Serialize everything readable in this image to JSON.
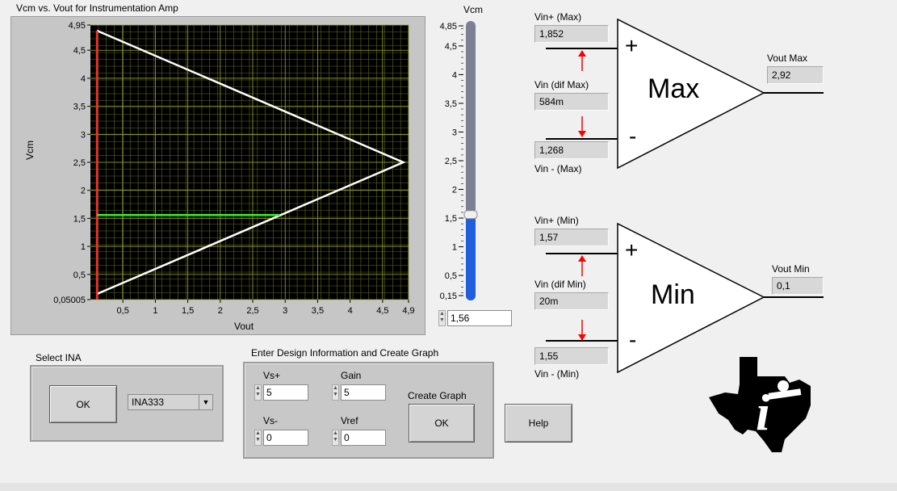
{
  "graph": {
    "title": "Vcm vs. Vout for Instrumentation Amp",
    "xlabel": "Vout",
    "ylabel": "Vcm"
  },
  "chart_data": {
    "type": "line",
    "title": "Vcm vs. Vout for Instrumentation Amp",
    "xlabel": "Vout",
    "ylabel": "Vcm",
    "xlim": [
      0,
      4.9
    ],
    "ylim": [
      0.05005,
      4.95
    ],
    "grid": true,
    "x_ticks": [
      "0,5",
      "1",
      "1,5",
      "2",
      "2,5",
      "3",
      "3,5",
      "4",
      "4,5",
      "4,9"
    ],
    "x_tick_values": [
      0.5,
      1,
      1.5,
      2,
      2.5,
      3,
      3.5,
      4,
      4.5,
      4.9
    ],
    "y_ticks": [
      "0,05005",
      "0,5",
      "1",
      "1,5",
      "2",
      "2,5",
      "3",
      "3,5",
      "4",
      "4,5",
      "4,95"
    ],
    "y_tick_values": [
      0.05005,
      0.5,
      1,
      1.5,
      2,
      2.5,
      3,
      3.5,
      4,
      4.5,
      4.95
    ],
    "series": [
      {
        "color": "#ffffff",
        "x": [
          0.1,
          4.82,
          0.1
        ],
        "y": [
          4.85,
          2.5,
          0.15
        ]
      },
      {
        "color": "#ff2a2a",
        "x": [
          0.1,
          0.1
        ],
        "y": [
          0.05005,
          4.85
        ]
      },
      {
        "color": "#33ee33",
        "x": [
          0.1,
          2.92
        ],
        "y": [
          1.56,
          1.56
        ]
      }
    ]
  },
  "slider": {
    "title": "Vcm",
    "max": 4.85,
    "min": 0.15,
    "value": 1.56,
    "value_text": "1,56",
    "tick_labels": [
      {
        "v": 4.85,
        "t": "4,85"
      },
      {
        "v": 4.5,
        "t": "4,5"
      },
      {
        "v": 4,
        "t": "4"
      },
      {
        "v": 3.5,
        "t": "3,5"
      },
      {
        "v": 3,
        "t": "3"
      },
      {
        "v": 2.5,
        "t": "2,5"
      },
      {
        "v": 2,
        "t": "2"
      },
      {
        "v": 1.5,
        "t": "1,5"
      },
      {
        "v": 1,
        "t": "1"
      },
      {
        "v": 0.5,
        "t": "0,5"
      },
      {
        "v": 0.15,
        "t": "0,15"
      }
    ]
  },
  "amp_max": {
    "vin_plus_label": "Vin+ (Max)",
    "vin_plus_value": "1,852",
    "vin_dif_label": "Vin (dif Max)",
    "vin_dif_value": "584m",
    "vin_minus_value": "1,268",
    "vin_minus_label": "Vin - (Max)",
    "name": "Max",
    "plus": "+",
    "minus": "-",
    "vout_label": "Vout Max",
    "vout_value": "2,92"
  },
  "amp_min": {
    "vin_plus_label": "Vin+ (Min)",
    "vin_plus_value": "1,57",
    "vin_dif_label": "Vin (dif Min)",
    "vin_dif_value": "20m",
    "vin_minus_value": "1,55",
    "vin_minus_label": "Vin - (Min)",
    "name": "Min",
    "plus": "+",
    "minus": "-",
    "vout_label": "Vout Min",
    "vout_value": "0,1"
  },
  "select_ina": {
    "title": "Select INA",
    "ok_label": "OK",
    "dropdown_value": "INA333"
  },
  "design": {
    "title": "Enter Design Information and Create Graph",
    "vs_plus_label": "Vs+",
    "vs_plus_value": "5",
    "gain_label": "Gain",
    "gain_value": "5",
    "vs_minus_label": "Vs-",
    "vs_minus_value": "0",
    "vref_label": "Vref",
    "vref_value": "0",
    "create_graph_label": "Create Graph",
    "ok_label": "OK"
  },
  "help_label": "Help",
  "logo_icon": "ti-texas-logo-icon"
}
